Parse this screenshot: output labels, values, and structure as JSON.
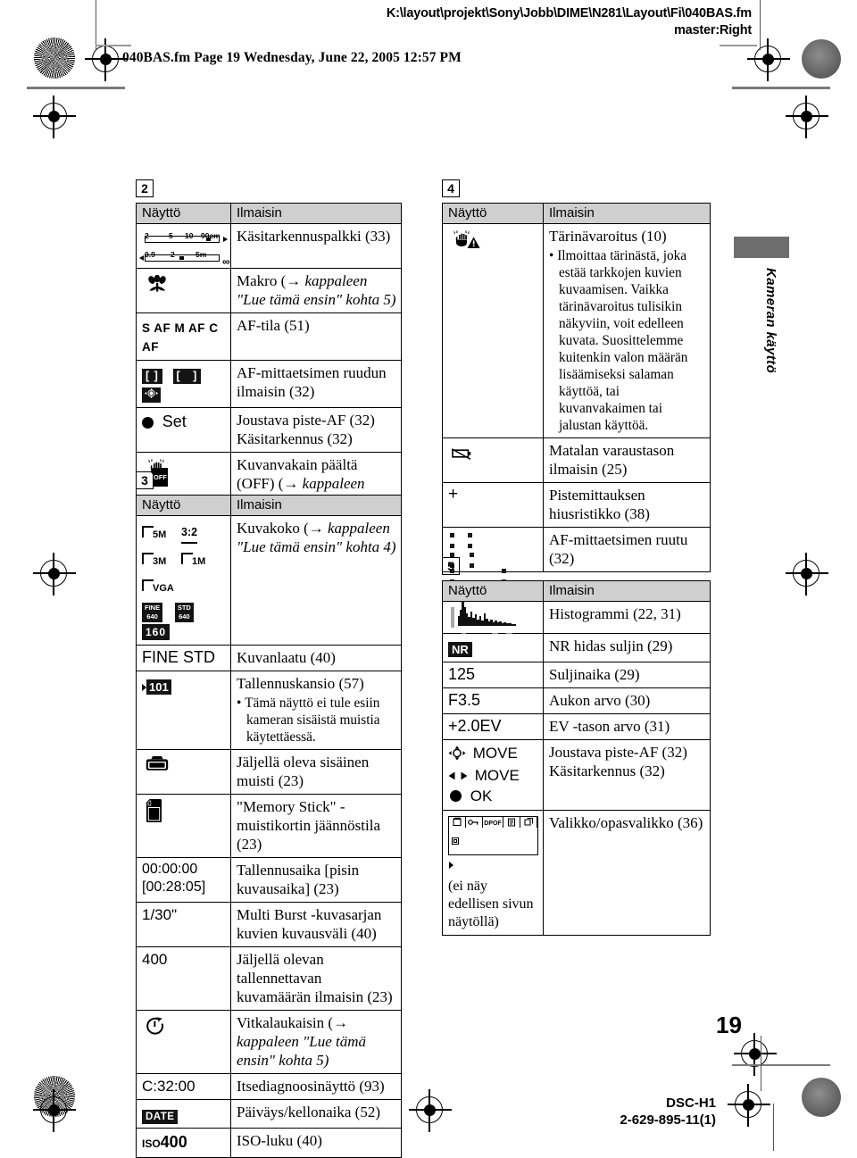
{
  "header": {
    "filepath_line1": "K:\\layout\\projekt\\Sony\\Jobb\\DIME\\N281\\Layout\\Fi\\040BAS.fm",
    "filepath_line2": "master:Right",
    "fm_line": "040BAS.fm  Page 19  Wednesday, June 22, 2005  12:57 PM"
  },
  "side_tab": {
    "label": "Kameran käyttö"
  },
  "footer": {
    "page_number": "19",
    "model": "DSC-H1",
    "part_number": "2-629-895-11(1)"
  },
  "columns": {
    "display_header": "Näyttö",
    "indicator_header": "Ilmaisin"
  },
  "sections": [
    {
      "number": "2",
      "rows": [
        {
          "display_kind": "mf-bar",
          "mf_bar": {
            "top_ticks": [
              "2",
              "5",
              "10",
              "90cm"
            ],
            "bottom_ticks": [
              "0.9",
              "2",
              "5m"
            ],
            "infinity": "∞"
          },
          "indicator": "Käsitarkennuspalkki (33)"
        },
        {
          "display_kind": "macro-icon",
          "indicator_pre": "Makro (",
          "indicator_italic": " kappaleen \"Lue tämä ensin\" kohta 5)"
        },
        {
          "display_kind": "af-mode-text",
          "af_mode_text": "S AF  M AF  C AF",
          "indicator": "AF-tila (51)"
        },
        {
          "display_kind": "af-chips",
          "af_chips": [
            "[ ]",
            "[   ]",
            "◈"
          ],
          "indicator": "AF-mittaetsimen ruudun ilmaisin (32)"
        },
        {
          "display_kind": "set-dot",
          "set_label": "Set",
          "indicator_l1": "Joustava piste-AF (32)",
          "indicator_l2": "Käsitarkennus (32)"
        },
        {
          "display_kind": "steadyshot-off",
          "steadyshot_label": "OFF",
          "indicator_pre": "Kuvanvakain päältä (OFF) (",
          "indicator_italic": " kappaleen \"Lue tämä ensin\" kohta 5)"
        }
      ]
    },
    {
      "number": "3",
      "rows": [
        {
          "display_kind": "image-sizes",
          "image_sizes": [
            "5M",
            "3:2",
            "3M",
            "1M",
            "VGA"
          ],
          "movie_sizes": [
            "FINE 640",
            "STD 640",
            "160"
          ],
          "indicator_pre": "Kuvakoko (",
          "indicator_italic": " kappaleen \"Lue tämä ensin\" kohta 4)"
        },
        {
          "display_kind": "text",
          "display": "FINE STD",
          "indicator": "Kuvanlaatu (40)"
        },
        {
          "display_kind": "folder-chip",
          "folder_label": "101",
          "indicator": "Tallennuskansio (57)",
          "bullet": "Tämä näyttö ei tule esiin kameran sisäistä muistia käytettäessä."
        },
        {
          "display_kind": "internal-memory-icon",
          "indicator": "Jäljellä oleva sisäinen muisti (23)"
        },
        {
          "display_kind": "memory-stick-icon",
          "indicator": "\"Memory Stick\" -muistikortin jäännöstila (23)"
        },
        {
          "display_kind": "text-2line",
          "display_l1": "00:00:00",
          "display_l2": "[00:28:05]",
          "indicator": "Tallennusaika [pisin kuvausaika] (23)"
        },
        {
          "display_kind": "text",
          "display": "1/30\"",
          "indicator": "Multi Burst -kuvasarjan kuvien kuvausväli (40)"
        },
        {
          "display_kind": "text",
          "display": "400",
          "indicator": "Jäljellä olevan tallennettavan kuvamäärän ilmaisin (23)"
        },
        {
          "display_kind": "selftimer-icon",
          "indicator_pre": "Vitkalaukaisin (",
          "indicator_italic": " kappaleen \"Lue tämä ensin\" kohta 5)"
        },
        {
          "display_kind": "text",
          "display": "C:32:00",
          "indicator": "Itsediagnoosinäyttö (93)"
        },
        {
          "display_kind": "date-chip",
          "date_label": "DATE",
          "indicator": "Päiväys/kellonaika (52)"
        },
        {
          "display_kind": "iso",
          "iso_prefix": "ISO",
          "iso_value": "400",
          "indicator": "ISO-luku (40)"
        }
      ]
    },
    {
      "number": "4",
      "rows": [
        {
          "display_kind": "shake-warning",
          "indicator": "Tärinävaroitus (10)",
          "bullet": "Ilmoittaa tärinästä, joka estää tarkkojen kuvien kuvaamisen. Vaikka tärinävaroitus tulisikin näkyviin, voit edelleen kuvata. Suosittelemme kuitenkin valon määrän lisäämiseksi salaman käyttöä, tai kuvanvakaimen tai jalustan käyttöä."
        },
        {
          "display_kind": "low-battery-icon",
          "indicator": "Matalan varaustason ilmaisin (25)"
        },
        {
          "display_kind": "text",
          "display": "+",
          "indicator": "Pistemittauksen hiusristikko (38)"
        },
        {
          "display_kind": "af-range-dots",
          "indicator": "AF-mittaetsimen ruutu (32)"
        }
      ]
    },
    {
      "number": "5",
      "rows": [
        {
          "display_kind": "histogram",
          "indicator": "Histogrammi (22, 31)"
        },
        {
          "display_kind": "nr-chip",
          "nr_label": "NR",
          "indicator": "NR hidas suljin (29)"
        },
        {
          "display_kind": "text",
          "display": "125",
          "indicator": "Suljinaika (29)"
        },
        {
          "display_kind": "text",
          "display": "F3.5",
          "indicator": "Aukon arvo (30)"
        },
        {
          "display_kind": "text",
          "display": "+2.0EV",
          "indicator": "EV -tason arvo (31)"
        },
        {
          "display_kind": "move-ok",
          "move_l1": "MOVE",
          "move_l2": "MOVE",
          "move_l3": "OK",
          "indicator_l1": "Joustava piste-AF (32)",
          "indicator_l2": "Käsitarkennus (32)"
        },
        {
          "display_kind": "menu-strip",
          "menu_note": "(ei näy edellisen sivun näytöllä)",
          "indicator": "Valikko/opasvalikko (36)"
        }
      ]
    }
  ]
}
